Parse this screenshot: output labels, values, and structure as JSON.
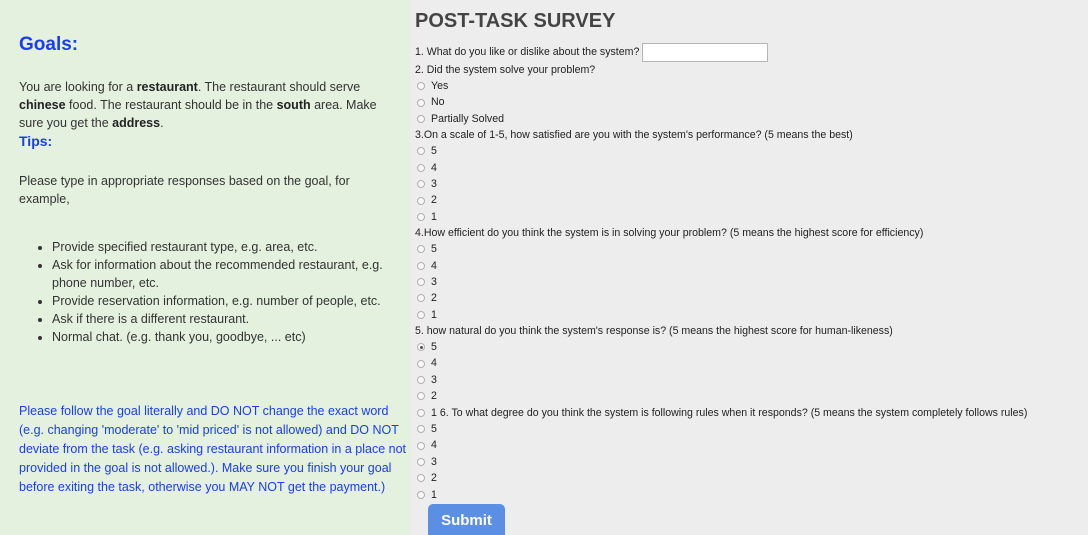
{
  "left": {
    "goals_title": "Goals:",
    "goal_parts": [
      "You are looking for a ",
      "restaurant",
      ". The restaurant should serve ",
      "chinese",
      " food. The restaurant should be in the ",
      "south",
      " area. Make sure you get the ",
      "address",
      "."
    ],
    "tips_title": "Tips:",
    "tips_intro": "Please type in appropriate responses based on the goal, for example,",
    "tips": [
      "Provide specified restaurant type, e.g. area, etc.",
      "Ask for information about the recommended restaurant, e.g. phone number, etc.",
      "Provide reservation information, e.g. number of people, etc.",
      "Ask if there is a different restaurant.",
      "Normal chat. (e.g. thank you, goodbye, ... etc)"
    ],
    "warning": "Please follow the goal literally and DO NOT change the exact word (e.g. changing 'moderate' to 'mid priced' is not allowed) and DO NOT deviate from the task (e.g. asking restaurant information in a place not provided in the goal is not allowed.). Make sure you finish your goal before exiting the task, otherwise you MAY NOT get the payment.)"
  },
  "survey": {
    "title": "POST-TASK SURVEY",
    "q1": "1. What do you like or dislike about the system?",
    "q1_value": "",
    "q2": "2. Did the system solve your problem?",
    "q2_options": [
      "Yes",
      "No",
      "Partially Solved"
    ],
    "q3": "3.On a scale of 1-5, how satisfied are you with the system's performance? (5 means the best)",
    "q3_options": [
      "5",
      "4",
      "3",
      "2",
      "1"
    ],
    "q4": "4.How efficient do you think the system is in solving your problem? (5 means the highest score for efficiency)",
    "q4_options": [
      "5",
      "4",
      "3",
      "2",
      "1"
    ],
    "q5": "5. how natural do you think the system's response is? (5 means the highest score for human-likeness)",
    "q5_options": [
      "5",
      "4",
      "3",
      "2",
      "1"
    ],
    "q5_selected": "5",
    "q6": "6. To what degree do you think the system is following rules when it responds? (5 means the system completely follows rules)",
    "q6_options": [
      "5",
      "4",
      "3",
      "2",
      "1"
    ],
    "submit_label": "Submit"
  }
}
